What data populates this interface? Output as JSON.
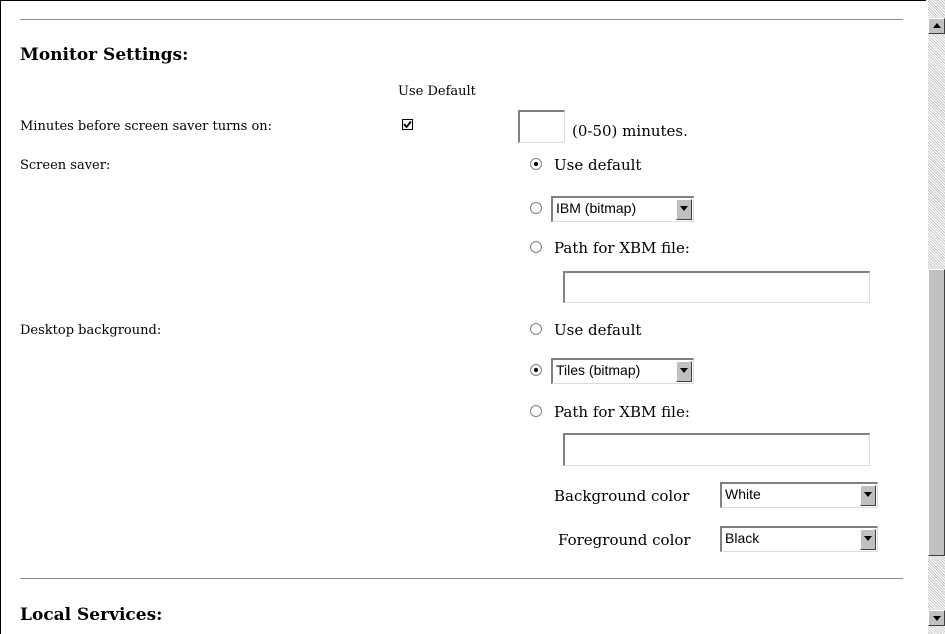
{
  "monitor": {
    "heading": "Monitor Settings:",
    "use_default_header": "Use Default",
    "minutes_label": "Minutes before screen saver turns on:",
    "minutes_use_default_checked": true,
    "minutes_value": "",
    "minutes_hint": "(0-50) minutes.",
    "screen_saver": {
      "label": "Screen saver:",
      "use_default_label": "Use default",
      "selected": "use_default",
      "dropdown_value": "IBM (bitmap)",
      "path_label": "Path for XBM file:",
      "path_value": ""
    },
    "desktop_background": {
      "label": "Desktop background:",
      "use_default_label": "Use default",
      "selected": "dropdown",
      "dropdown_value": "Tiles (bitmap)",
      "path_label": "Path for XBM file:",
      "path_value": "",
      "background_color_label": "Background color",
      "background_color_value": "White",
      "foreground_color_label": "Foreground color",
      "foreground_color_value": "Black"
    }
  },
  "local_services": {
    "heading": "Local Services:"
  },
  "icons": [
    "checkmark-icon",
    "radio-selected-icon",
    "radio-empty-icon",
    "dropdown-arrow-icon",
    "scroll-up-arrow-icon",
    "scroll-down-arrow-icon"
  ]
}
